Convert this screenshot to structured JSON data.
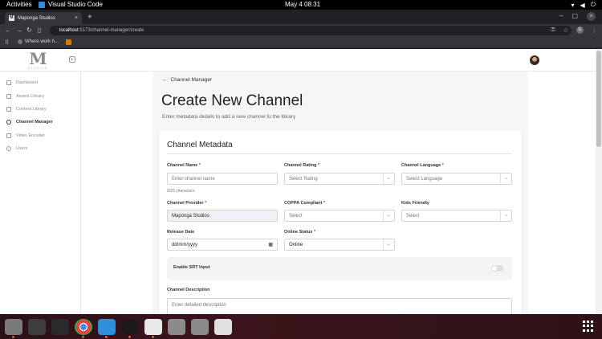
{
  "system_bar": {
    "activities": "Activities",
    "app_name": "Visual Studio Code",
    "datetime": "May 4  08:31"
  },
  "browser": {
    "tab_title": "Maponga Studios",
    "tab_favicon": "M",
    "url_host": "localhost",
    "url_path": ":5173/channel-manager/create",
    "bookmark_label": "Where work h...",
    "profile_initial": "G"
  },
  "app": {
    "logo_letter": "M",
    "logo_sub": "STUDIOS",
    "sidebar": {
      "items": [
        {
          "label": "Dashboard",
          "icon": "folder-icon"
        },
        {
          "label": "Assets Library",
          "icon": "folder-icon"
        },
        {
          "label": "Content Library",
          "icon": "folder-icon"
        },
        {
          "label": "Channel Manager",
          "icon": "globe-icon",
          "active": true
        },
        {
          "label": "Video Encoder",
          "icon": "folder-icon"
        },
        {
          "label": "Users",
          "icon": "user-icon"
        }
      ]
    },
    "breadcrumb": "Channel Manager",
    "page_title": "Create New Channel",
    "page_subtitle": "Enter metadata details to add a new channel to the library",
    "card_title": "Channel Metadata",
    "form": {
      "channel_name_label": "Channel Name",
      "channel_name_placeholder": "Enter channel name",
      "channel_name_counter": "0/25 characters",
      "channel_rating_label": "Channel Rating",
      "channel_rating_value": "Select Rating",
      "channel_language_label": "Channel Language",
      "channel_language_value": "Select Language",
      "channel_provider_label": "Channel Provider",
      "channel_provider_value": "Maponga Studios",
      "coppa_label": "COPPA Compliant",
      "coppa_value": "Select",
      "kids_label": "Kids Friendly",
      "kids_value": "Select",
      "release_date_label": "Release Date",
      "release_date_value": "dd/mm/yyyy",
      "online_status_label": "Online Status",
      "online_status_value": "Online",
      "srt_label": "Enable SRT Input",
      "srt_enabled": false,
      "description_label": "Channel Description",
      "description_placeholder": "Enter detailed description",
      "required_mark": "*"
    }
  },
  "colors": {
    "accent_required": "#d93025",
    "main_bg": "#f5f6f8",
    "taskbar": "#3b151b"
  }
}
